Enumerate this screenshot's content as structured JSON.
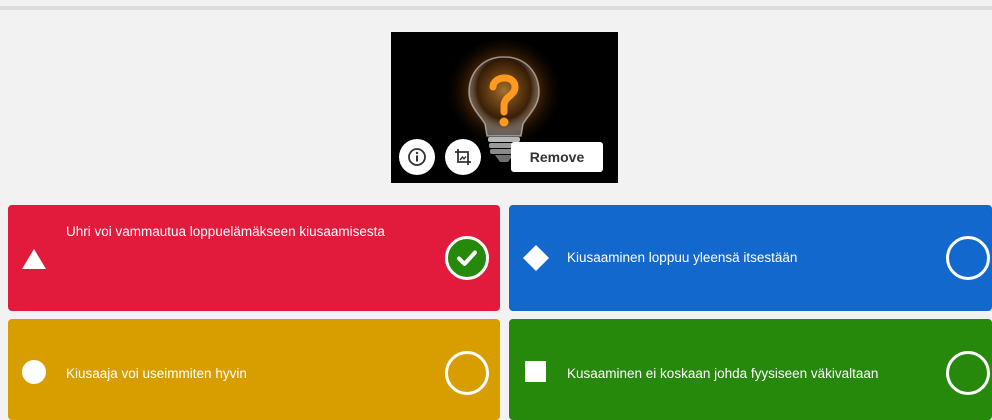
{
  "media": {
    "remove_label": "Remove"
  },
  "answers": [
    {
      "text": "Uhri voi vammautua loppuelämäkseen kiusaamisesta",
      "color": "#e21b3c",
      "shape": "triangle",
      "correct": true
    },
    {
      "text": "Kiusaaminen loppuu yleensä itsestään",
      "color": "#1368ce",
      "shape": "diamond",
      "correct": false
    },
    {
      "text": "Kiusaaja voi useimmiten hyvin",
      "color": "#d89e00",
      "shape": "circle",
      "correct": false
    },
    {
      "text": "Kusaaminen ei koskaan johda fyysiseen väkivaltaan",
      "color": "#26890c",
      "shape": "square",
      "correct": false
    }
  ],
  "icons": {
    "info": "info-icon",
    "crop": "crop-icon",
    "correct": "check-icon"
  }
}
